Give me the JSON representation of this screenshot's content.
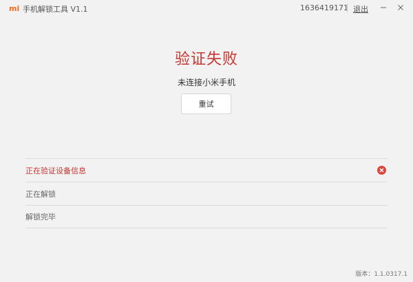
{
  "titlebar": {
    "logo": "mi",
    "title": "手机解锁工具 V1.1",
    "account": "1636419171",
    "logout": "退出",
    "minimize_icon": "minimize-icon",
    "close_icon": "close-icon"
  },
  "status": {
    "title": "验证失败",
    "subtitle": "未连接小米手机",
    "retry_label": "重试"
  },
  "steps": [
    {
      "label": "正在验证设备信息",
      "state": "error",
      "icon": "error-x-icon"
    },
    {
      "label": "正在解锁",
      "state": "pending"
    },
    {
      "label": "解锁完毕",
      "state": "pending"
    }
  ],
  "version": "版本：1.1.0317.1",
  "colors": {
    "accent_red": "#c8352e",
    "logo_orange": "#f26b1d",
    "background": "#f2f2f2"
  }
}
